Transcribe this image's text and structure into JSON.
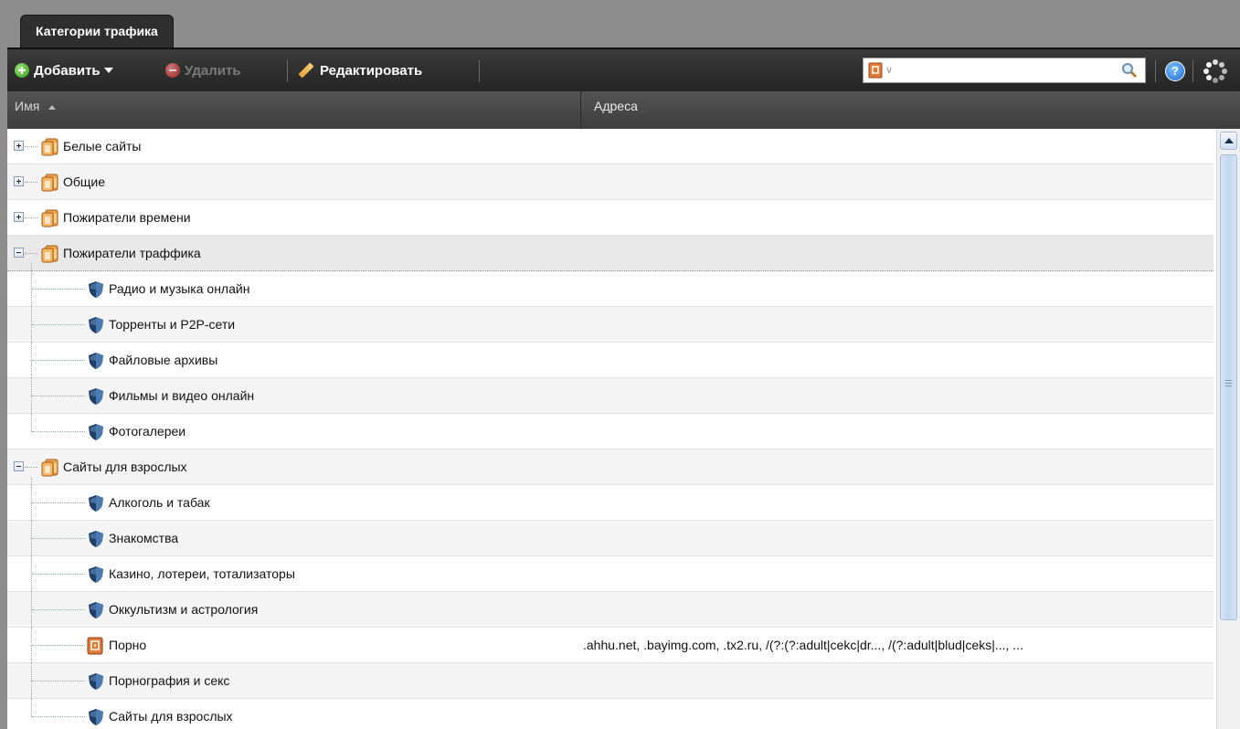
{
  "tab": {
    "title": "Категории трафика"
  },
  "toolbar": {
    "add_label": "Добавить",
    "delete_label": "Удалить",
    "edit_label": "Редактировать",
    "search_value": "",
    "colors": {
      "add": "#2e9a16",
      "delete": "#c02020",
      "bar": "#2b2b2b"
    }
  },
  "grid": {
    "columns": {
      "name": "Имя",
      "addresses": "Адреса"
    },
    "sort": {
      "column": "name",
      "direction": "ascending"
    },
    "rows": [
      {
        "label": "Белые сайты",
        "type": "folder",
        "level": 0,
        "expanded": false,
        "addresses": ""
      },
      {
        "label": "Общие",
        "type": "folder",
        "level": 0,
        "expanded": false,
        "addresses": ""
      },
      {
        "label": "Пожиратели времени",
        "type": "folder",
        "level": 0,
        "expanded": false,
        "addresses": ""
      },
      {
        "label": "Пожиратели траффика",
        "type": "folder",
        "level": 0,
        "expanded": true,
        "selected": true,
        "addresses": ""
      },
      {
        "label": "Радио и музыка онлайн",
        "type": "shield",
        "level": 1,
        "addresses": ""
      },
      {
        "label": "Торренты и P2P-сети",
        "type": "shield",
        "level": 1,
        "addresses": ""
      },
      {
        "label": "Файловые архивы",
        "type": "shield",
        "level": 1,
        "addresses": ""
      },
      {
        "label": "Фильмы и видео онлайн",
        "type": "shield",
        "level": 1,
        "addresses": ""
      },
      {
        "label": "Фотогалереи",
        "type": "shield",
        "level": 1,
        "last": true,
        "addresses": ""
      },
      {
        "label": "Сайты для взрослых",
        "type": "folder",
        "level": 0,
        "expanded": true,
        "addresses": ""
      },
      {
        "label": "Алкоголь и табак",
        "type": "shield",
        "level": 1,
        "addresses": ""
      },
      {
        "label": "Знакомства",
        "type": "shield",
        "level": 1,
        "addresses": ""
      },
      {
        "label": "Казино, лотереи, тотализаторы",
        "type": "shield",
        "level": 1,
        "addresses": ""
      },
      {
        "label": "Оккультизм и астрология",
        "type": "shield",
        "level": 1,
        "addresses": ""
      },
      {
        "label": "Порно",
        "type": "book",
        "level": 1,
        "addresses": ".ahhu.net, .bayimg.com, .tx2.ru, /(?:(?:adult|cekc|dr..., /(?:adult|blud|ceks|..., ..."
      },
      {
        "label": "Порнография и секс",
        "type": "shield",
        "level": 1,
        "addresses": ""
      },
      {
        "label": "Сайты для взрослых",
        "type": "shield",
        "level": 1,
        "last": true,
        "addresses": ""
      }
    ]
  }
}
